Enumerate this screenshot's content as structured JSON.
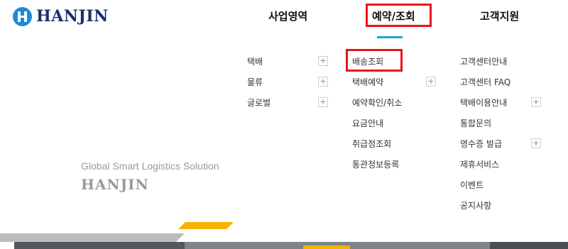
{
  "brand": {
    "name": "HANJIN",
    "logo_icon": "hanjin-h-circle-icon",
    "accent": "#1e8ad8"
  },
  "gnb": {
    "business": "사업영역",
    "reservation": "예약/조회",
    "support": "고객지원"
  },
  "submenu": {
    "business": [
      {
        "label": "택배",
        "expandable": true
      },
      {
        "label": "물류",
        "expandable": true
      },
      {
        "label": "글로벌",
        "expandable": true
      }
    ],
    "reservation": [
      {
        "label": "배송조회",
        "expandable": false
      },
      {
        "label": "택배예약",
        "expandable": true
      },
      {
        "label": "예약확인/취소",
        "expandable": false
      },
      {
        "label": "요금안내",
        "expandable": false
      },
      {
        "label": "취급점조회",
        "expandable": false
      },
      {
        "label": "통관정보등록",
        "expandable": false
      }
    ],
    "support": [
      {
        "label": "고객센터안내",
        "expandable": false
      },
      {
        "label": "고객센터 FAQ",
        "expandable": false
      },
      {
        "label": "택배이용안내",
        "expandable": true
      },
      {
        "label": "통합문의",
        "expandable": false
      },
      {
        "label": "영수증 발급",
        "expandable": true
      },
      {
        "label": "제휴서비스",
        "expandable": false
      },
      {
        "label": "이벤트",
        "expandable": false
      },
      {
        "label": "공지사항",
        "expandable": false
      }
    ]
  },
  "plus_symbol": "+",
  "hero": {
    "tagline": "Global Smart Logistics Solution",
    "brand_text": "HANJIN"
  },
  "colors": {
    "highlight": "#e8141c",
    "underline": "#1aa2d6",
    "deco_yellow": "#f5b400"
  }
}
